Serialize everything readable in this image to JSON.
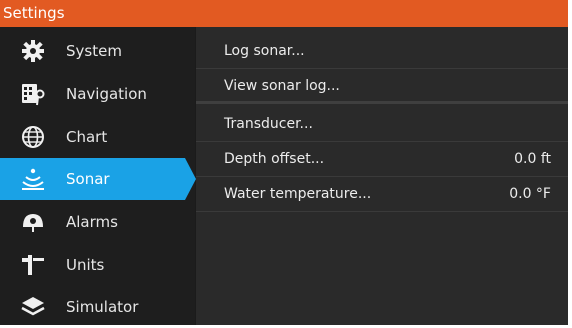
{
  "window": {
    "title": "Settings"
  },
  "sidebar": {
    "items": [
      {
        "label": "System",
        "icon": "gear-icon",
        "active": false
      },
      {
        "label": "Navigation",
        "icon": "navigation-map-icon",
        "active": false
      },
      {
        "label": "Chart",
        "icon": "globe-icon",
        "active": false
      },
      {
        "label": "Sonar",
        "icon": "sonar-icon",
        "active": true
      },
      {
        "label": "Alarms",
        "icon": "alarm-icon",
        "active": false
      },
      {
        "label": "Units",
        "icon": "units-icon",
        "active": false
      },
      {
        "label": "Simulator",
        "icon": "simulator-layers-icon",
        "active": false
      }
    ]
  },
  "main": {
    "rows": [
      {
        "label": "Log sonar...",
        "value": ""
      },
      {
        "label": "View sonar log...",
        "value": ""
      },
      {
        "label": "Transducer...",
        "value": ""
      },
      {
        "label": "Depth offset...",
        "value": "0.0 ft"
      },
      {
        "label": "Water temperature...",
        "value": "0.0 °F"
      }
    ]
  },
  "colors": {
    "accent": "#1aa2e6",
    "titlebar": "#e25a22",
    "panel": "#2a2a2a",
    "sidebar": "#1e1e1e"
  }
}
